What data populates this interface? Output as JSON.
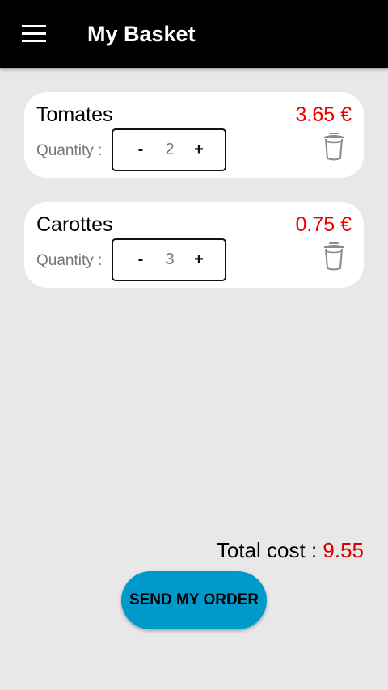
{
  "toolbar": {
    "menu_icon": "hamburger-menu-icon",
    "title": "My Basket"
  },
  "basket": {
    "items": [
      {
        "name": "Tomates",
        "price": "3.65 €",
        "quantity_label": "Quantity :",
        "quantity": "2",
        "minus": "-",
        "plus": "+",
        "delete_icon": "trash-icon"
      },
      {
        "name": "Carottes",
        "price": "0.75 €",
        "quantity_label": "Quantity :",
        "quantity": "3",
        "minus": "-",
        "plus": "+",
        "delete_icon": "trash-icon"
      }
    ]
  },
  "summary": {
    "total_label": "Total cost : ",
    "total_value": "9.55",
    "send_label": "SEND MY ORDER"
  },
  "colors": {
    "toolbar_bg": "#000000",
    "background": "#e8e8e8",
    "price": "#ee0000",
    "accent_button": "#0099cc"
  }
}
